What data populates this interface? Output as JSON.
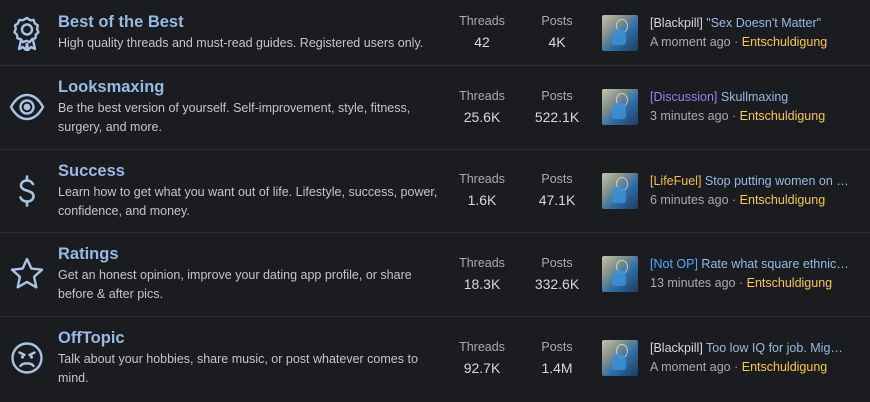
{
  "forums": [
    {
      "icon": "award-icon",
      "title": "Best of the Best",
      "description": "High quality threads and must-read guides. Registered users only.",
      "threads_label": "Threads",
      "threads": "42",
      "posts_label": "Posts",
      "posts": "4K",
      "last_post": {
        "prefix": "[Blackpill]",
        "prefix_color": "#d6d8dc",
        "title": "\"Sex Doesn't Matter\"",
        "time": "A moment ago",
        "separator": "·",
        "user": "Entschuldigung"
      }
    },
    {
      "icon": "eye-icon",
      "title": "Looksmaxing",
      "description": "Be the best version of yourself. Self-improvement, style, fitness, surgery, and more.",
      "threads_label": "Threads",
      "threads": "25.6K",
      "posts_label": "Posts",
      "posts": "522.1K",
      "last_post": {
        "prefix": "[Discussion]",
        "prefix_color": "#9a7ff0",
        "title": "Skullmaxing",
        "time": "3 minutes ago",
        "separator": "·",
        "user": "Entschuldigung"
      }
    },
    {
      "icon": "dollar-icon",
      "title": "Success",
      "description": "Learn how to get what you want out of life. Lifestyle, success, power, confidence, and money.",
      "threads_label": "Threads",
      "threads": "1.6K",
      "posts_label": "Posts",
      "posts": "47.1K",
      "last_post": {
        "prefix": "[LifeFuel]",
        "prefix_color": "#f0c233",
        "title": "Stop putting women on …",
        "time": "6 minutes ago",
        "separator": "·",
        "user": "Entschuldigung"
      }
    },
    {
      "icon": "star-icon",
      "title": "Ratings",
      "description": "Get an honest opinion, improve your dating app profile, or share before & after pics.",
      "threads_label": "Threads",
      "threads": "18.3K",
      "posts_label": "Posts",
      "posts": "332.6K",
      "last_post": {
        "prefix": "[Not OP]",
        "prefix_color": "#56a8f5",
        "title": "Rate what square ethnic…",
        "time": "13 minutes ago",
        "separator": "·",
        "user": "Entschuldigung"
      }
    },
    {
      "icon": "angry-face-icon",
      "title": "OffTopic",
      "description": "Talk about your hobbies, share music, or post whatever comes to mind.",
      "threads_label": "Threads",
      "threads": "92.7K",
      "posts_label": "Posts",
      "posts": "1.4M",
      "last_post": {
        "prefix": "[Blackpill]",
        "prefix_color": "#d6d8dc",
        "title": "Too low IQ for job. Mig…",
        "time": "A moment ago",
        "separator": "·",
        "user": "Entschuldigung"
      }
    }
  ]
}
